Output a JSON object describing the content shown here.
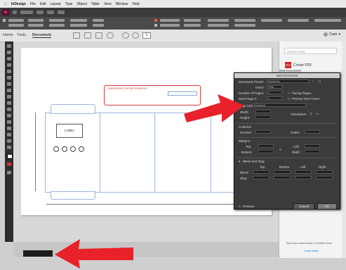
{
  "menubar": {
    "items": [
      "InDesign",
      "File",
      "Edit",
      "Layout",
      "Type",
      "Object",
      "Table",
      "View",
      "Window",
      "Help"
    ]
  },
  "app": {
    "logo": "Id"
  },
  "homebar": {
    "home": "Home",
    "tools": "Tools",
    "document": "Document",
    "page_number": "1",
    "user_label": "Cam"
  },
  "right_panel": {
    "search_placeholder": "Search Tools",
    "create_pdf": "Create PDF",
    "new_document": "New Document",
    "footer_text": "Store your current place in Creative Cloud",
    "learn_more": "Learn More"
  },
  "dialog": {
    "document_preset_label": "Document Preset:",
    "document_preset_value": "[Custom]",
    "intent_label": "Intent:",
    "intent_value": "Print",
    "num_pages_label": "Number of Pages:",
    "num_pages_value": "1",
    "facing_pages_label": "Facing Pages",
    "start_page_label": "Start Page #:",
    "start_page_value": "1",
    "primary_text_frame_label": "Primary Text Frame",
    "page_size_label": "Page Size:",
    "page_size_value": "[Custom]",
    "width_label": "Width:",
    "height_label": "Height:",
    "orientation_label": "Orientation:",
    "columns_label": "Columns",
    "number_label": "Number:",
    "gutter_label": "Gutter:",
    "margins_label": "Margins",
    "top_label": "Top:",
    "bottom_label": "Bottom:",
    "left_label": "Left:",
    "right_label": "Right:",
    "bleed_slug_label": "Bleed and Slug",
    "bleed_cols": [
      "Top",
      "Bottom",
      "Left",
      "Right"
    ],
    "bleed_label": "Bleed:",
    "slug_label": "Slug:",
    "preview_label": "Preview",
    "cancel_label": "Cancel",
    "ok_label": "OK"
  },
  "canvas": {
    "label_box_text": "LABEL",
    "callout_title": "DIMENSIONS / DIE INFORMATION"
  },
  "colors": {
    "accent_pink": "#ff5d9b",
    "arrow_red": "#e8212a",
    "guide_blue": "#9fb4e2",
    "pdf_red": "#d6252d"
  }
}
